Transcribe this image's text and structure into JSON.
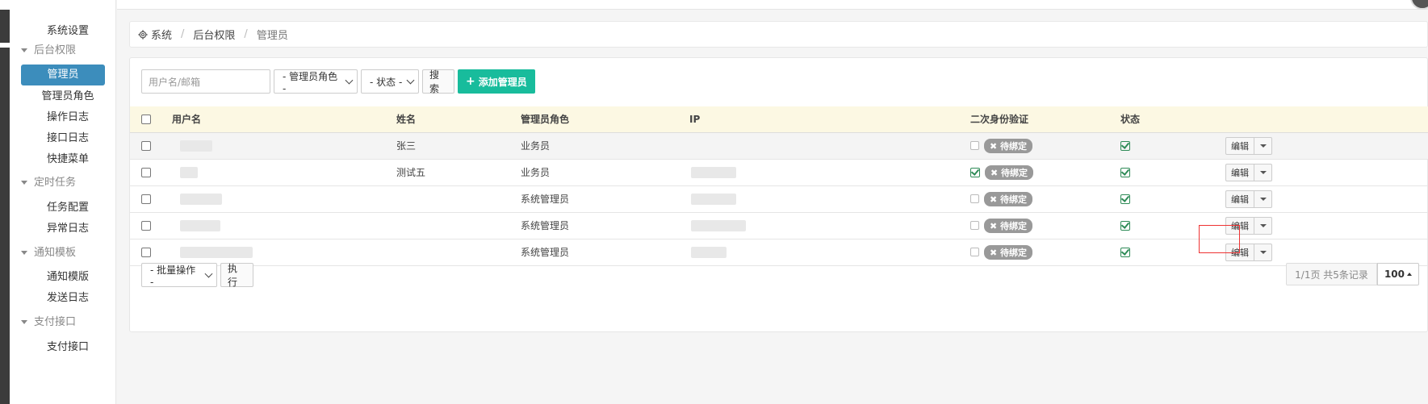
{
  "breadcrumb": {
    "root": "系统",
    "level2": "后台权限",
    "current": "管理员"
  },
  "sidebar": {
    "items": [
      {
        "label": "系统设置"
      },
      {
        "label": "后台权限",
        "group": true
      },
      {
        "label": "管理员",
        "active": true
      },
      {
        "label": "管理员角色"
      },
      {
        "label": "操作日志"
      },
      {
        "label": "接口日志"
      },
      {
        "label": "快捷菜单"
      },
      {
        "label": "定时任务",
        "group": true
      },
      {
        "label": "任务配置"
      },
      {
        "label": "异常日志"
      },
      {
        "label": "通知模板",
        "group": true
      },
      {
        "label": "通知模版"
      },
      {
        "label": "发送日志"
      },
      {
        "label": "支付接口",
        "group": true
      },
      {
        "label": "支付接口"
      }
    ]
  },
  "toolbar": {
    "search_placeholder": "用户名/邮箱",
    "role_select": "- 管理员角色 -",
    "status_select": "- 状态 -",
    "search_button": "搜索",
    "add_button": "添加管理员",
    "add_icon": "plus-icon"
  },
  "table": {
    "columns": [
      "用户名",
      "姓名",
      "管理员角色",
      "IP",
      "二次身份验证",
      "状态"
    ],
    "rows": [
      {
        "name": "张三",
        "role": "业务员",
        "twofa_checked": false,
        "twofa_badge": "待绑定",
        "status": true,
        "edit": "编辑"
      },
      {
        "name": "测试五",
        "role": "业务员",
        "twofa_checked": true,
        "twofa_badge": "待绑定",
        "status": true,
        "edit": "编辑"
      },
      {
        "name": "",
        "role": "系统管理员",
        "twofa_checked": false,
        "twofa_badge": "待绑定",
        "status": true,
        "edit": "编辑"
      },
      {
        "name": "",
        "role": "系统管理员",
        "twofa_checked": false,
        "twofa_badge": "待绑定",
        "status": true,
        "edit": "编辑"
      },
      {
        "name": "",
        "role": "系统管理员",
        "twofa_checked": false,
        "twofa_badge": "待绑定",
        "status": true,
        "edit": "编辑"
      }
    ]
  },
  "footer": {
    "batch_select": "- 批量操作 -",
    "execute_button": "执行",
    "pager_info": "1/1页 共5条记录",
    "page_size": "100"
  },
  "colors": {
    "primary": "#3c8dbc",
    "success": "#18bc9c",
    "header_bg": "#fcf8e3",
    "badge": "#999999"
  }
}
